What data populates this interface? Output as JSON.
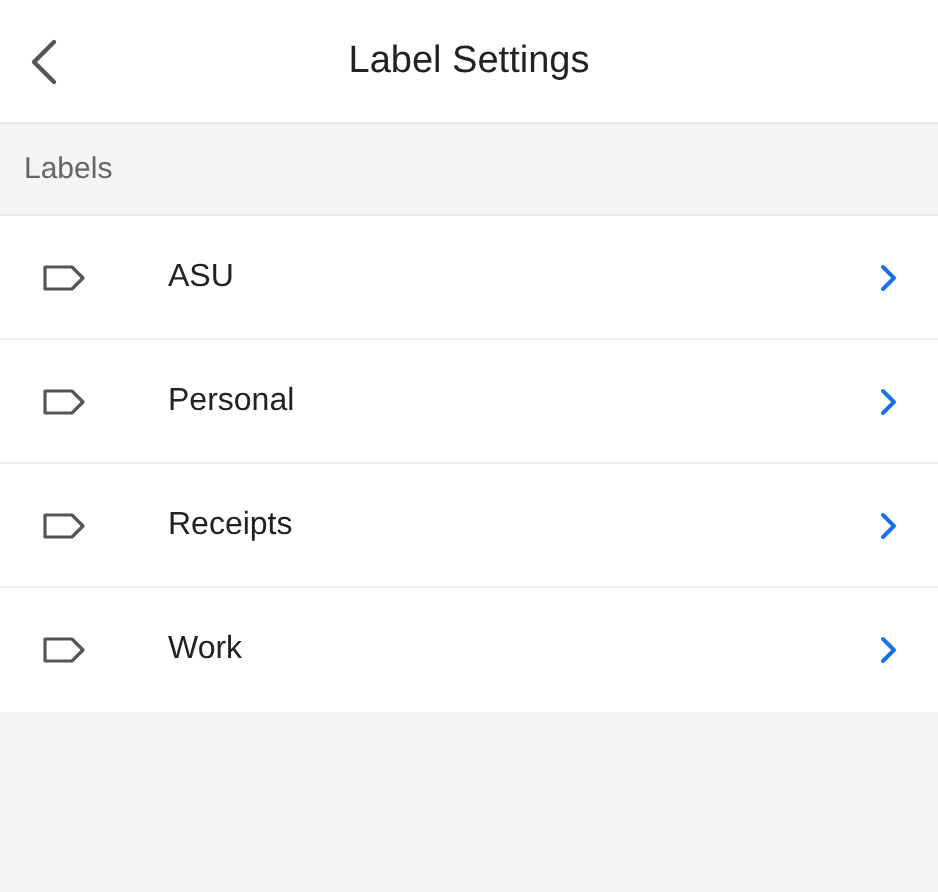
{
  "header": {
    "title": "Label Settings"
  },
  "section": {
    "title": "Labels"
  },
  "labels": [
    {
      "name": "ASU"
    },
    {
      "name": "Personal"
    },
    {
      "name": "Receipts"
    },
    {
      "name": "Work"
    }
  ]
}
